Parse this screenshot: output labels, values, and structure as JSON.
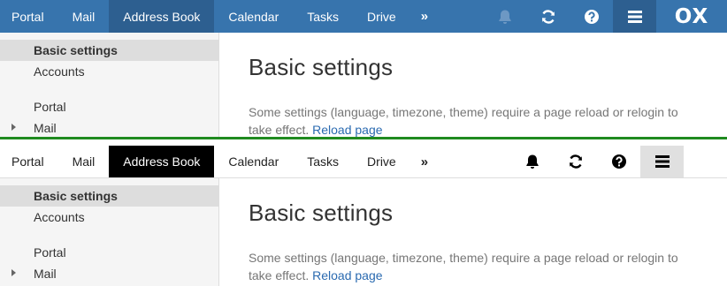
{
  "tabs": [
    "Portal",
    "Mail",
    "Address Book",
    "Calendar",
    "Tasks",
    "Drive",
    "»"
  ],
  "active_tab": "Address Book",
  "icons": {
    "notifications": "bell-icon",
    "refresh": "refresh-icon",
    "help": "help-icon",
    "menu": "hamburger-menu-icon"
  },
  "logo": "OX",
  "sidebar": {
    "items": [
      "Basic settings",
      "Accounts",
      "Portal",
      "Mail"
    ],
    "selected": "Basic settings"
  },
  "content": {
    "title": "Basic settings",
    "description": "Some settings (language, timezone, theme) require a page reload or relogin to take effect.",
    "link": "Reload page"
  },
  "themes": {
    "top": {
      "topbar_bg": "#3774ad",
      "active_tab_bg": "#2d5f90",
      "text": "#ffffff"
    },
    "bottom": {
      "topbar_bg": "#ffffff",
      "active_tab_bg": "#000000",
      "text": "#222222"
    },
    "separator": "#1f8a1f",
    "link": "#2a6ab0"
  }
}
